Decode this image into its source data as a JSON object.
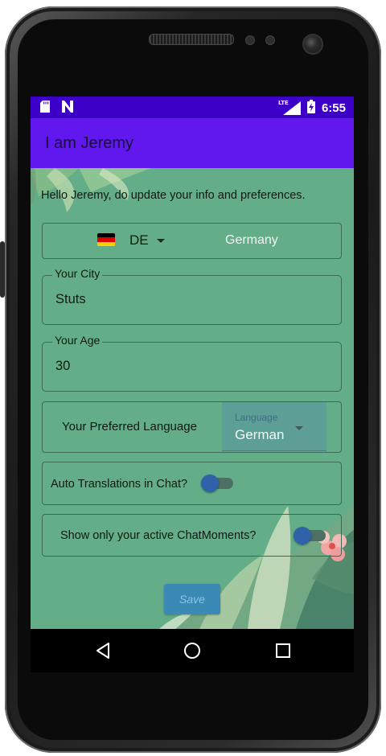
{
  "status_bar": {
    "left_icons": [
      "sd-card-icon",
      "n-icon"
    ],
    "right_icons": [
      "lte-signal-icon",
      "battery-icon"
    ],
    "network_label": "LTE",
    "time": "6:55"
  },
  "app_bar": {
    "title": "I am Jeremy",
    "color": "#6018ee"
  },
  "content": {
    "background": "#63ad88",
    "greeting": "Hello Jeremy, do update your info and preferences.",
    "country_picker": {
      "flag": "germany-flag-icon",
      "code": "DE",
      "name": "Germany"
    },
    "city_field": {
      "label": "Your City",
      "value": "Stuts"
    },
    "age_field": {
      "label": "Your Age",
      "value": "30"
    },
    "language_pref": {
      "label": "Your Preferred Language",
      "dropdown_label": "Language",
      "dropdown_value": "German"
    },
    "auto_translate": {
      "label": "Auto Translations in Chat?",
      "enabled": false
    },
    "active_moments": {
      "label": "Show only your active ChatMoments?",
      "enabled": false
    },
    "save_label": "Save"
  },
  "nav_bar": {
    "icons": [
      "back-icon",
      "home-icon",
      "recents-icon"
    ]
  }
}
